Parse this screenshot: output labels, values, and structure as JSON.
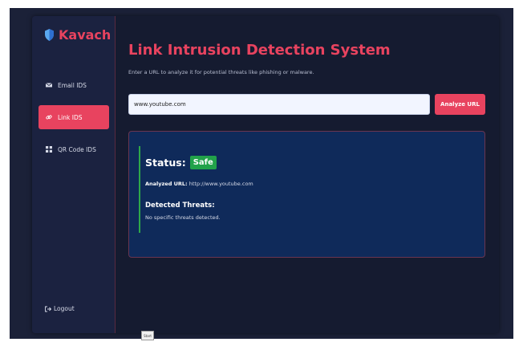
{
  "brand": {
    "name": "Kavach",
    "icon": "shield-icon"
  },
  "sidebar": {
    "items": [
      {
        "label": "Email IDS",
        "icon": "mail-icon"
      },
      {
        "label": "Link IDS",
        "icon": "link-icon",
        "active": true
      },
      {
        "label": "QR Code IDS",
        "icon": "qr-icon"
      }
    ],
    "logout_label": "Logout"
  },
  "main": {
    "title": "Link Intrusion Detection System",
    "subtitle": "Enter a URL to analyze it for potential threats like phishing or malware.",
    "url_value": "www.youtube.com",
    "analyze_label": "Analyze URL"
  },
  "result": {
    "status_label": "Status:",
    "status_value": "Safe",
    "analyzed_label": "Analyzed URL:",
    "analyzed_url": "http://www.youtube.com",
    "threats_heading": "Detected Threats:",
    "threats_text": "No specific threats detected."
  },
  "taskbar": {
    "start_label": "Start"
  },
  "colors": {
    "accent": "#e8435f",
    "safe": "#22a24a",
    "panel": "#0f2a5a",
    "background": "#151b30"
  }
}
